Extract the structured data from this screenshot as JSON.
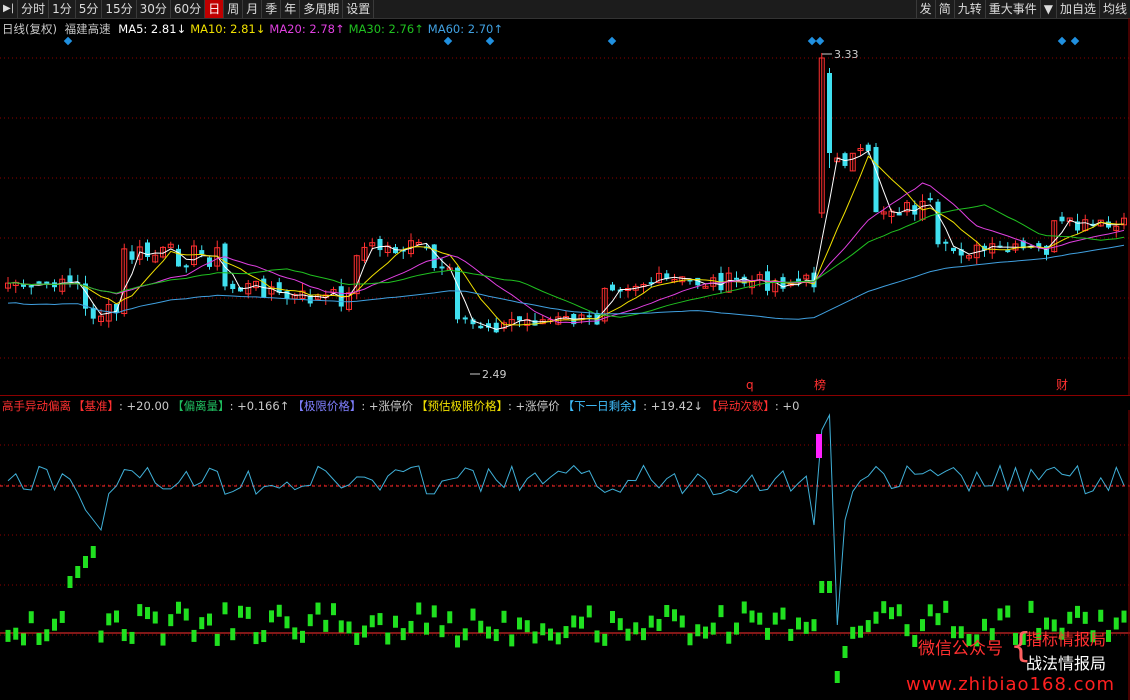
{
  "toolbar": {
    "play_icon": "play-step-icon",
    "left_tabs": [
      "分时",
      "1分",
      "5分",
      "15分",
      "30分",
      "60分",
      "日",
      "周",
      "月",
      "季",
      "年",
      "多周期",
      "设置"
    ],
    "active_tab": "日",
    "right_tabs": [
      "发",
      "简",
      "九转",
      "重大事件",
      "▼",
      "加自选",
      "均线"
    ]
  },
  "main_legend": {
    "period": "日线(复权)",
    "stock_name": "福建高速",
    "ma": [
      {
        "label": "MA5: 2.81↓",
        "color": "#ffffff"
      },
      {
        "label": "MA10: 2.81↓",
        "color": "#f0e000"
      },
      {
        "label": "MA20: 2.78↑",
        "color": "#e040e0"
      },
      {
        "label": "MA30: 2.76↑",
        "color": "#20c020"
      },
      {
        "label": "MA60: 2.70↑",
        "color": "#40a0e0"
      }
    ]
  },
  "price_labels": {
    "high": "3.33",
    "low": "2.49"
  },
  "event_markers": [
    "q",
    "榜",
    "财"
  ],
  "indicator_legend": {
    "name": "高手异动偏离",
    "items": [
      {
        "label": "【基准】",
        "value": ": +20.00",
        "color": "#ff3030"
      },
      {
        "label": "【偏离量】",
        "value": ": +0.166↑",
        "color": "#20c060"
      },
      {
        "label": "【极限价格】",
        "value": ": +涨停价",
        "color": "#8080ff"
      },
      {
        "label": "【预估极限价格】",
        "value": ": +涨停价",
        "color": "#f0e000"
      },
      {
        "label": "【下一日剩余】",
        "value": ": +19.42↓",
        "color": "#40c0ff"
      },
      {
        "label": "【异动次数】",
        "value": ": +0",
        "color": "#ff3030"
      }
    ]
  },
  "watermark": {
    "wechat": "微信公众号",
    "line1": "指标情报局",
    "line2": "战法情报局",
    "url": "www.zhibiao168.com"
  },
  "colors": {
    "up": "#ff3030",
    "down": "#40e0f0",
    "grid": "#8b0000",
    "bg": "#000000"
  }
}
